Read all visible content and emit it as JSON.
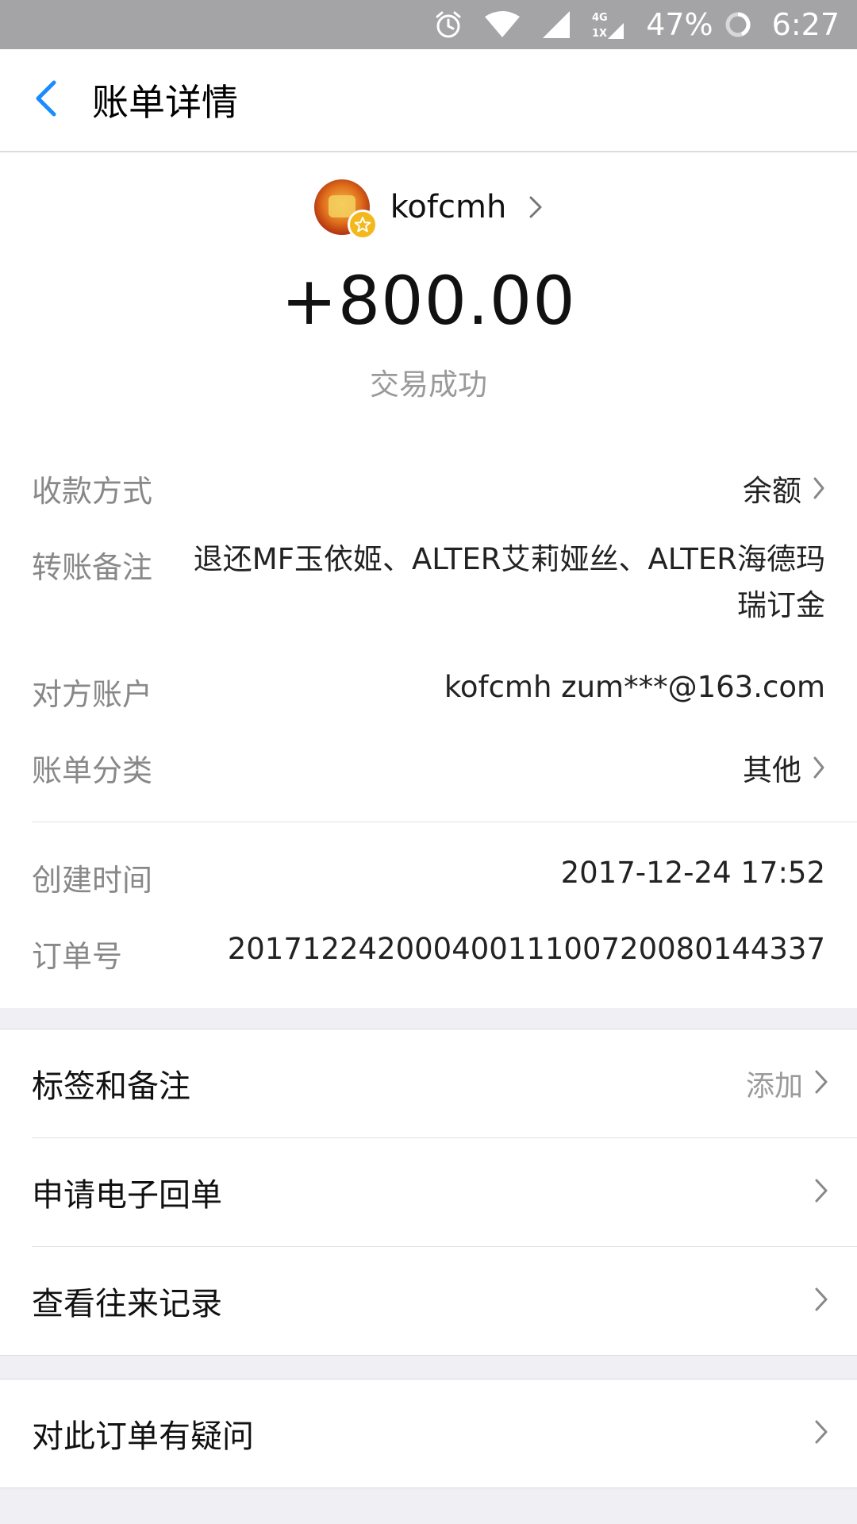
{
  "status_bar": {
    "battery": "47%",
    "time": "6:27",
    "network": "4G 1X"
  },
  "header": {
    "title": "账单详情"
  },
  "payee": {
    "name": "kofcmh"
  },
  "transaction": {
    "amount": "+800.00",
    "status": "交易成功"
  },
  "details": [
    {
      "label": "收款方式",
      "value": "余额"
    },
    {
      "label": "转账备注",
      "value": "退还MF玉依姬、ALTER艾莉娅丝、ALTER海德玛瑞订金"
    },
    {
      "label": "对方账户",
      "value": "kofcmh zum***@163.com"
    },
    {
      "label": "账单分类",
      "value": "其他"
    },
    {
      "label": "创建时间",
      "value": "2017-12-24 17:52"
    },
    {
      "label": "订单号",
      "value": "20171224200040011100720080144337"
    }
  ],
  "actions": {
    "tags_label": "标签和备注",
    "tags_hint": "添加",
    "receipt_label": "申请电子回单",
    "history_label": "查看往来记录",
    "question_label": "对此订单有疑问"
  },
  "colors": {
    "accent": "#1a8cff",
    "status_bar": "#a4a4a6",
    "background": "#efeff4",
    "badge": "#f2b81c"
  }
}
